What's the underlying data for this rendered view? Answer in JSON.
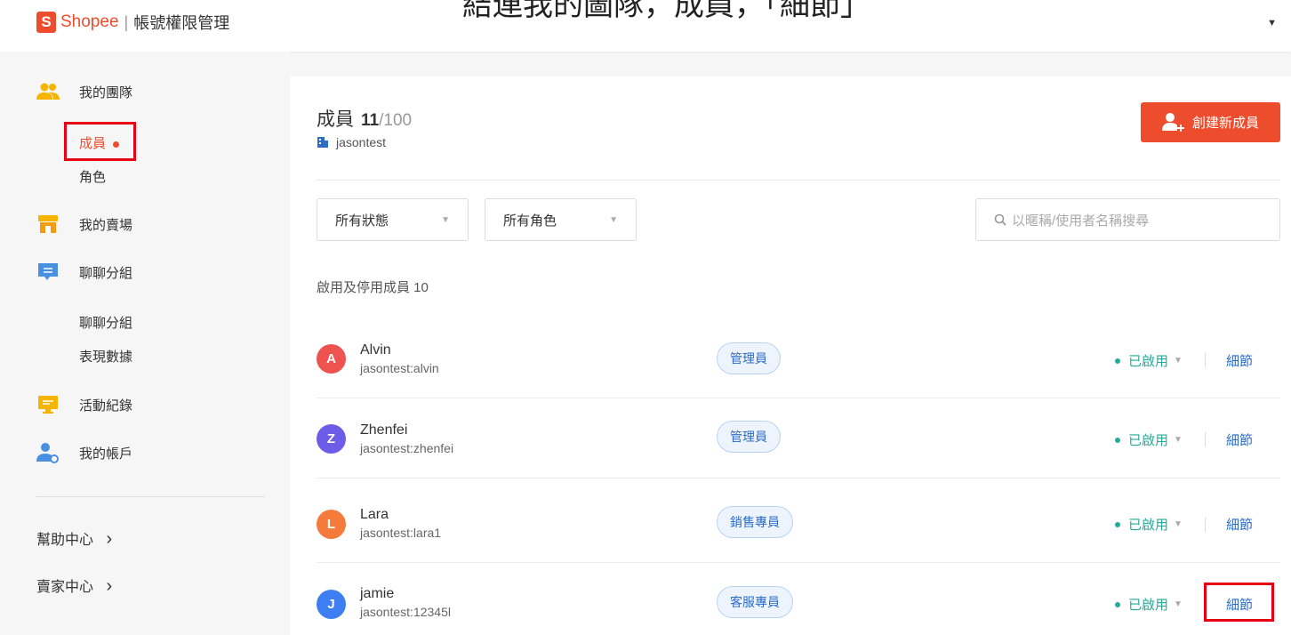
{
  "header": {
    "logo_mark": "S",
    "brand": "Shopee",
    "separator": "|",
    "title": "帳號權限管理",
    "dropdown_glyph": "▼",
    "banner_text": "結連我的圖隊，成員，「細節」"
  },
  "sidebar": {
    "team_label": "我的團隊",
    "members_label": "成員",
    "roles_label": "角色",
    "shop_label": "我的賣場",
    "chat_group_label": "聊聊分組",
    "chat_group_sub": "聊聊分組",
    "performance_label": "表現數據",
    "activity_label": "活動紀錄",
    "account_label": "我的帳戶",
    "help_center": "幫助中心",
    "seller_center": "賣家中心",
    "chevron": "›"
  },
  "main": {
    "title": "成員",
    "count": "11",
    "max": "/100",
    "shop_name": "jasontest",
    "create_button": "創建新成員",
    "status_filter": "所有狀態",
    "role_filter": "所有角色",
    "search_placeholder": "以暱稱/使用者名稱搜尋",
    "section_label": "啟用及停用成員 10",
    "detail_label": "細節"
  },
  "members": [
    {
      "initial": "A",
      "name": "Alvin",
      "username": "jasontest:alvin",
      "role": "管理員",
      "status": "已啟用",
      "avatar_color": "#ef5350"
    },
    {
      "initial": "Z",
      "name": "Zhenfei",
      "username": "jasontest:zhenfei",
      "role": "管理員",
      "status": "已啟用",
      "avatar_color": "#6c5ce7"
    },
    {
      "initial": "L",
      "name": "Lara",
      "username": "jasontest:lara1",
      "role": "銷售專員",
      "status": "已啟用",
      "avatar_color": "#f47b3b"
    },
    {
      "initial": "J",
      "name": "jamie",
      "username": "jasontest:12345l",
      "role": "客服專員",
      "status": "已啟用",
      "avatar_color": "#3d7ff2"
    }
  ],
  "colors": {
    "brand": "#ee4d2d",
    "highlight_box": "#e60012",
    "status_enabled": "#26aa99",
    "link": "#2e6cc6"
  },
  "icons": {
    "team": "users-icon",
    "shop": "store-icon",
    "chat": "chat-icon",
    "activity": "monitor-icon",
    "account": "user-gear-icon",
    "search": "search-icon",
    "add_user": "add-user-icon"
  }
}
